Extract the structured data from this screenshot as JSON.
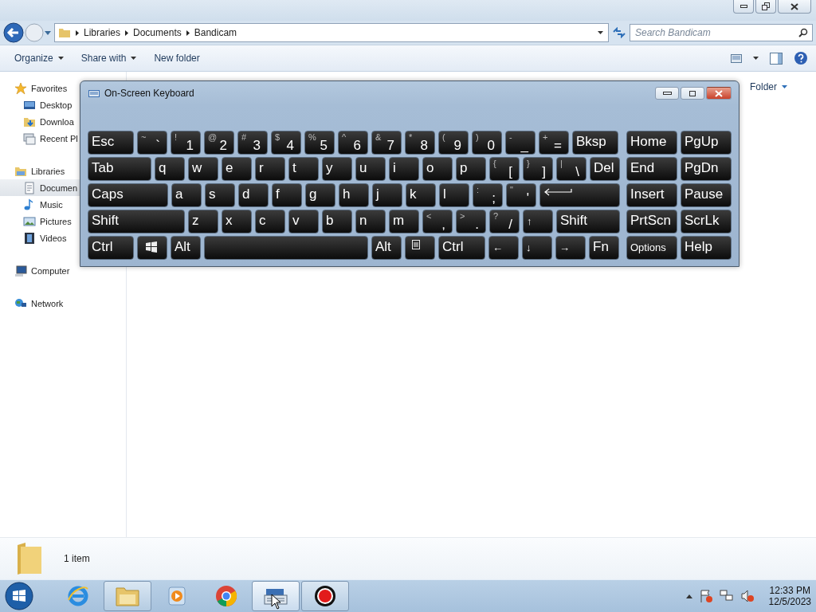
{
  "explorer": {
    "breadcrumb": [
      "Libraries",
      "Documents",
      "Bandicam"
    ],
    "search": {
      "placeholder": "Search Bandicam"
    },
    "toolbar": [
      {
        "label": "Organize",
        "dropdown": true
      },
      {
        "label": "Share with",
        "dropdown": true
      },
      {
        "label": "New folder",
        "dropdown": false
      }
    ],
    "sidebar": [
      {
        "label": "Favorites",
        "selected": false,
        "children": [
          {
            "label": "Desktop",
            "selected": false
          },
          {
            "label": "Downloa",
            "selected": false
          },
          {
            "label": "Recent Pl",
            "selected": false
          }
        ]
      },
      {
        "label": "Libraries",
        "selected": false,
        "children": [
          {
            "label": "Documen",
            "selected": true
          },
          {
            "label": "Music",
            "selected": false
          },
          {
            "label": "Pictures",
            "selected": false
          },
          {
            "label": "Videos",
            "selected": false
          }
        ]
      },
      {
        "label": "Computer",
        "selected": false
      },
      {
        "label": "Network",
        "selected": false
      }
    ],
    "arrange": "Folder",
    "status": "1 item"
  },
  "keyboard": {
    "title": "On-Screen Keyboard",
    "rows": [
      {
        "keys": [
          {
            "kind": "label",
            "main": "Esc"
          },
          {
            "kind": "dual",
            "shift": "~",
            "main": "`"
          },
          {
            "kind": "dual",
            "shift": "!",
            "main": "1"
          },
          {
            "kind": "dual",
            "shift": "@",
            "main": "2"
          },
          {
            "kind": "dual",
            "shift": "#",
            "main": "3"
          },
          {
            "kind": "dual",
            "shift": "$",
            "main": "4"
          },
          {
            "kind": "dual",
            "shift": "%",
            "main": "5"
          },
          {
            "kind": "dual",
            "shift": "^",
            "main": "6"
          },
          {
            "kind": "dual",
            "shift": "&",
            "main": "7"
          },
          {
            "kind": "dual",
            "shift": "*",
            "main": "8"
          },
          {
            "kind": "dual",
            "shift": "(",
            "main": "9"
          },
          {
            "kind": "dual",
            "shift": ")",
            "main": "0"
          },
          {
            "kind": "dual",
            "shift": "-",
            "main": "_"
          },
          {
            "kind": "dual",
            "shift": "+",
            "main": "="
          },
          {
            "kind": "label",
            "main": "Bksp"
          }
        ]
      },
      {
        "keys": [
          {
            "kind": "label",
            "main": "Tab"
          },
          {
            "kind": "label",
            "main": "q"
          },
          {
            "kind": "label",
            "main": "w"
          },
          {
            "kind": "label",
            "main": "e"
          },
          {
            "kind": "label",
            "main": "r"
          },
          {
            "kind": "label",
            "main": "t"
          },
          {
            "kind": "label",
            "main": "y"
          },
          {
            "kind": "label",
            "main": "u"
          },
          {
            "kind": "label",
            "main": "i"
          },
          {
            "kind": "label",
            "main": "o"
          },
          {
            "kind": "label",
            "main": "p"
          },
          {
            "kind": "dual",
            "shift": "{",
            "main": "["
          },
          {
            "kind": "dual",
            "shift": "}",
            "main": "]"
          },
          {
            "kind": "dual",
            "shift": "|",
            "main": "\\"
          },
          {
            "kind": "label",
            "main": "Del"
          }
        ]
      },
      {
        "keys": [
          {
            "kind": "label",
            "main": "Caps"
          },
          {
            "kind": "label",
            "main": "a"
          },
          {
            "kind": "label",
            "main": "s"
          },
          {
            "kind": "label",
            "main": "d"
          },
          {
            "kind": "label",
            "main": "f"
          },
          {
            "kind": "label",
            "main": "g"
          },
          {
            "kind": "label",
            "main": "h"
          },
          {
            "kind": "label",
            "main": "j"
          },
          {
            "kind": "label",
            "main": "k"
          },
          {
            "kind": "label",
            "main": "l"
          },
          {
            "kind": "dual",
            "shift": ":",
            "main": ";"
          },
          {
            "kind": "dual",
            "shift": "\"",
            "main": "'"
          },
          {
            "kind": "enter"
          }
        ]
      },
      {
        "keys": [
          {
            "kind": "label",
            "main": "Shift"
          },
          {
            "kind": "label",
            "main": "z"
          },
          {
            "kind": "label",
            "main": "x"
          },
          {
            "kind": "label",
            "main": "c"
          },
          {
            "kind": "label",
            "main": "v"
          },
          {
            "kind": "label",
            "main": "b"
          },
          {
            "kind": "label",
            "main": "n"
          },
          {
            "kind": "label",
            "main": "m"
          },
          {
            "kind": "dual",
            "shift": "<",
            "main": ","
          },
          {
            "kind": "dual",
            "shift": ">",
            "main": "."
          },
          {
            "kind": "dual",
            "shift": "?",
            "main": "/"
          },
          {
            "kind": "arrow",
            "main": "↑"
          },
          {
            "kind": "label",
            "main": "Shift"
          }
        ]
      },
      {
        "keys": [
          {
            "kind": "label",
            "main": "Ctrl"
          },
          {
            "kind": "windows"
          },
          {
            "kind": "label",
            "main": "Alt"
          },
          {
            "kind": "space"
          },
          {
            "kind": "label",
            "main": "Alt"
          },
          {
            "kind": "menu"
          },
          {
            "kind": "label",
            "main": "Ctrl"
          },
          {
            "kind": "arrow",
            "main": "←"
          },
          {
            "kind": "arrow",
            "main": "↓"
          },
          {
            "kind": "arrow",
            "main": "→"
          },
          {
            "kind": "label",
            "main": "Fn"
          }
        ]
      }
    ],
    "nav": [
      [
        {
          "kind": "label",
          "main": "Home"
        },
        {
          "kind": "label",
          "main": "PgUp"
        }
      ],
      [
        {
          "kind": "label",
          "main": "End"
        },
        {
          "kind": "label",
          "main": "PgDn"
        }
      ],
      [
        {
          "kind": "label",
          "main": "Insert"
        },
        {
          "kind": "label",
          "main": "Pause"
        }
      ],
      [
        {
          "kind": "label",
          "main": "PrtScn"
        },
        {
          "kind": "label",
          "main": "ScrLk"
        }
      ],
      [
        {
          "kind": "small",
          "main": "Options"
        },
        {
          "kind": "label",
          "main": "Help"
        }
      ]
    ]
  },
  "taskbar": {
    "apps": [
      {
        "kind": "ie",
        "running": false,
        "selected": false
      },
      {
        "kind": "explorer",
        "running": true,
        "selected": false
      },
      {
        "kind": "media",
        "running": false,
        "selected": false
      },
      {
        "kind": "chrome",
        "running": false,
        "selected": false
      },
      {
        "kind": "keyboard",
        "running": true,
        "selected": true
      },
      {
        "kind": "record",
        "running": true,
        "selected": false
      }
    ],
    "time": "12:33 PM",
    "date": "12/5/2023"
  }
}
